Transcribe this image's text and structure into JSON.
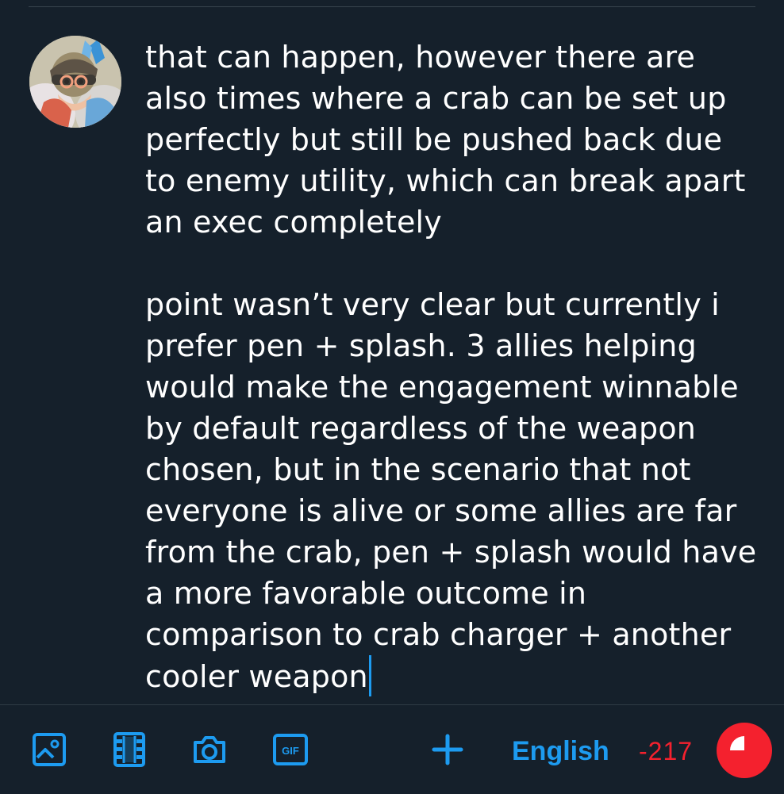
{
  "compose": {
    "paragraphs": [
      "that can happen, however there are also times where a crab can be set up perfectly but still be pushed back due to enemy utility, which can break apart an exec completely",
      "point wasn’t very clear but currently i prefer pen + splash. 3 allies helping would make the engagement winnable by default regardless of the weapon chosen, but in the scenario that not everyone is alive or some allies are far from the crab, pen + splash would have a more favorable outcome in comparison to crab charger + another cooler weapon"
    ]
  },
  "toolbar": {
    "icons": [
      "image-icon",
      "video-icon",
      "camera-icon",
      "gif-icon",
      "plus-icon"
    ],
    "gif_label": "GIF",
    "language": "English",
    "char_counter": "-217"
  },
  "colors": {
    "background": "#15202b",
    "accent": "#1d9bf0",
    "warning": "#f4212e",
    "text": "#ffffff"
  }
}
